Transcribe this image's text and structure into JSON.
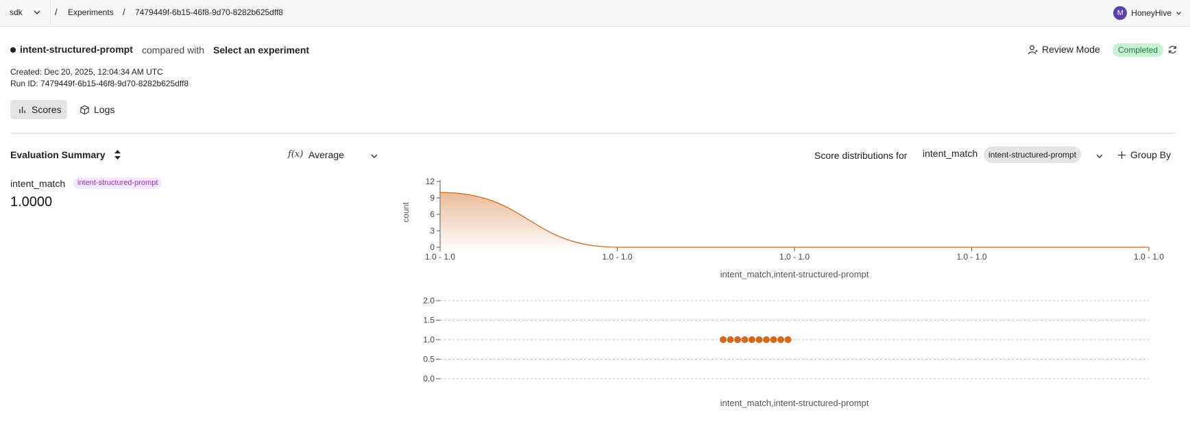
{
  "nav": {
    "project": "sdk",
    "separator": "/",
    "breadcrumb_experiments": "Experiments",
    "breadcrumb_run": "7479449f-6b15-46f8-9d70-8282b625dff8",
    "user_initial": "M",
    "user_name": "HoneyHive"
  },
  "header": {
    "run_name": "intent-structured-prompt",
    "compared_with": "compared with",
    "select_experiment": "Select an experiment",
    "review_mode": "Review Mode",
    "status": "Completed",
    "created": "Created: Dec 20, 2025, 12:04:34 AM UTC",
    "run_id": "Run ID: 7479449f-6b15-46f8-9d70-8282b625dff8"
  },
  "tabs": [
    {
      "label": "Scores",
      "icon": "bar-chart-icon",
      "active": true
    },
    {
      "label": "Logs",
      "icon": "cube-icon",
      "active": false
    }
  ],
  "summary": {
    "title": "Evaluation Summary",
    "aggregation_icon": "f(x)",
    "aggregation": "Average",
    "metric_name": "intent_match",
    "metric_tag": "intent-structured-prompt",
    "metric_value": "1.0000"
  },
  "distribution": {
    "label": "Score distributions for",
    "metric": "intent_match",
    "tag": "intent-structured-prompt",
    "group_by": "Group By"
  },
  "colors": {
    "accent": "#d2691e",
    "status_bg": "#c9f2d4",
    "status_fg": "#1c7a3e",
    "tag_purple": "#9a37c7",
    "avatar": "#5b3fb0"
  },
  "chart_data": [
    {
      "type": "area",
      "ylabel": "count",
      "xlabel": "intent_match,intent-structured-prompt",
      "x_ticks": [
        "1.0 - 1.0",
        "1.0 - 1.0",
        "1.0 - 1.0",
        "1.0 - 1.0",
        "1.0 - 1.0"
      ],
      "y_ticks": [
        0,
        3,
        6,
        9,
        12
      ],
      "ylim": [
        0,
        12
      ],
      "values": [
        10,
        0,
        0,
        0,
        0
      ]
    },
    {
      "type": "scatter",
      "xlabel": "intent_match,intent-structured-prompt",
      "y_ticks": [
        "2.0",
        "1.5",
        "1.0",
        "0.5",
        "0.0"
      ],
      "ylim": [
        0,
        2
      ],
      "points": [
        1.0,
        1.0,
        1.0,
        1.0,
        1.0,
        1.0,
        1.0,
        1.0,
        1.0,
        1.0
      ]
    }
  ]
}
